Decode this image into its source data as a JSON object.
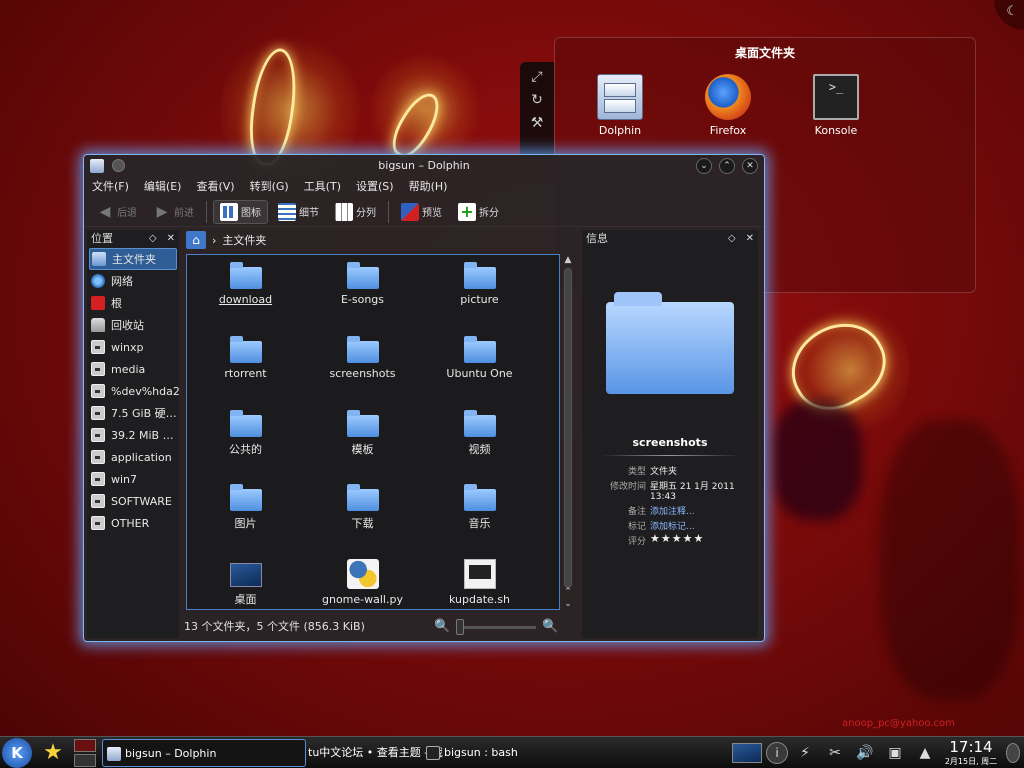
{
  "desktop": {
    "folderview_title": "桌面文件夹",
    "items": [
      {
        "label": "Dolphin",
        "icon": "file-cabinet-icon"
      },
      {
        "label": "Firefox",
        "icon": "firefox-icon"
      },
      {
        "label": "Konsole",
        "icon": "terminal-icon"
      }
    ],
    "konsole_prompt": ">_",
    "email": "anoop_pc@yahoo.com"
  },
  "window": {
    "title": "bigsun – Dolphin",
    "menu": [
      "文件(F)",
      "编辑(E)",
      "查看(V)",
      "转到(G)",
      "工具(T)",
      "设置(S)",
      "帮助(H)"
    ],
    "toolbar": {
      "back": "后退",
      "forward": "前进",
      "icons": "图标",
      "details": "细节",
      "columns": "分列",
      "preview": "预览",
      "split": "拆分"
    }
  },
  "places": {
    "title": "位置",
    "items": [
      {
        "label": "主文件夹",
        "icon": "home-icon",
        "selected": true
      },
      {
        "label": "网络",
        "icon": "network-icon"
      },
      {
        "label": "根",
        "icon": "root-folder-icon"
      },
      {
        "label": "回收站",
        "icon": "trash-icon"
      },
      {
        "label": "winxp",
        "icon": "drive-icon"
      },
      {
        "label": "media",
        "icon": "drive-icon"
      },
      {
        "label": "%dev%hda2",
        "icon": "drive-icon"
      },
      {
        "label": "7.5 GiB 硬…",
        "icon": "drive-icon"
      },
      {
        "label": "39.2 MiB …",
        "icon": "drive-icon"
      },
      {
        "label": "application",
        "icon": "drive-icon"
      },
      {
        "label": "win7",
        "icon": "drive-icon"
      },
      {
        "label": "SOFTWARE",
        "icon": "drive-icon"
      },
      {
        "label": "OTHER",
        "icon": "drive-icon"
      }
    ]
  },
  "breadcrumb": {
    "current": "主文件夹"
  },
  "files": [
    {
      "name": "download",
      "type": "folder"
    },
    {
      "name": "E-songs",
      "type": "folder"
    },
    {
      "name": "picture",
      "type": "folder"
    },
    {
      "name": "rtorrent",
      "type": "folder"
    },
    {
      "name": "screenshots",
      "type": "folder"
    },
    {
      "name": "Ubuntu One",
      "type": "folder"
    },
    {
      "name": "公共的",
      "type": "folder"
    },
    {
      "name": "模板",
      "type": "folder"
    },
    {
      "name": "视频",
      "type": "folder"
    },
    {
      "name": "图片",
      "type": "folder"
    },
    {
      "name": "下载",
      "type": "folder"
    },
    {
      "name": "音乐",
      "type": "folder"
    },
    {
      "name": "桌面",
      "type": "desktop"
    },
    {
      "name": "gnome-wall.py",
      "type": "python"
    },
    {
      "name": "kupdate.sh",
      "type": "script"
    }
  ],
  "status": {
    "summary": "13 个文件夹，5 个文件 (856.3 KiB)"
  },
  "info": {
    "title": "信息",
    "name": "screenshots",
    "type_key": "类型",
    "type_val": "文件夹",
    "modified_key": "修改时间",
    "modified_val": "星期五 21 1月 2011 13:43",
    "comment_key": "备注",
    "comment_val": "添加注释...",
    "tags_key": "标记",
    "tags_val": "添加标记...",
    "rating_key": "评分",
    "rating_stars": "★★★★★"
  },
  "taskbar": {
    "kmenu": "K",
    "tasks": [
      {
        "label": "bigsun – Dolphin",
        "active": true
      },
      {
        "label": "tu中文论坛 • 查看主题 - 俄",
        "active": false
      },
      {
        "label": "bigsun : bash",
        "active": false
      }
    ],
    "clock_time": "17:14",
    "clock_date": "2月15日, 周二"
  }
}
